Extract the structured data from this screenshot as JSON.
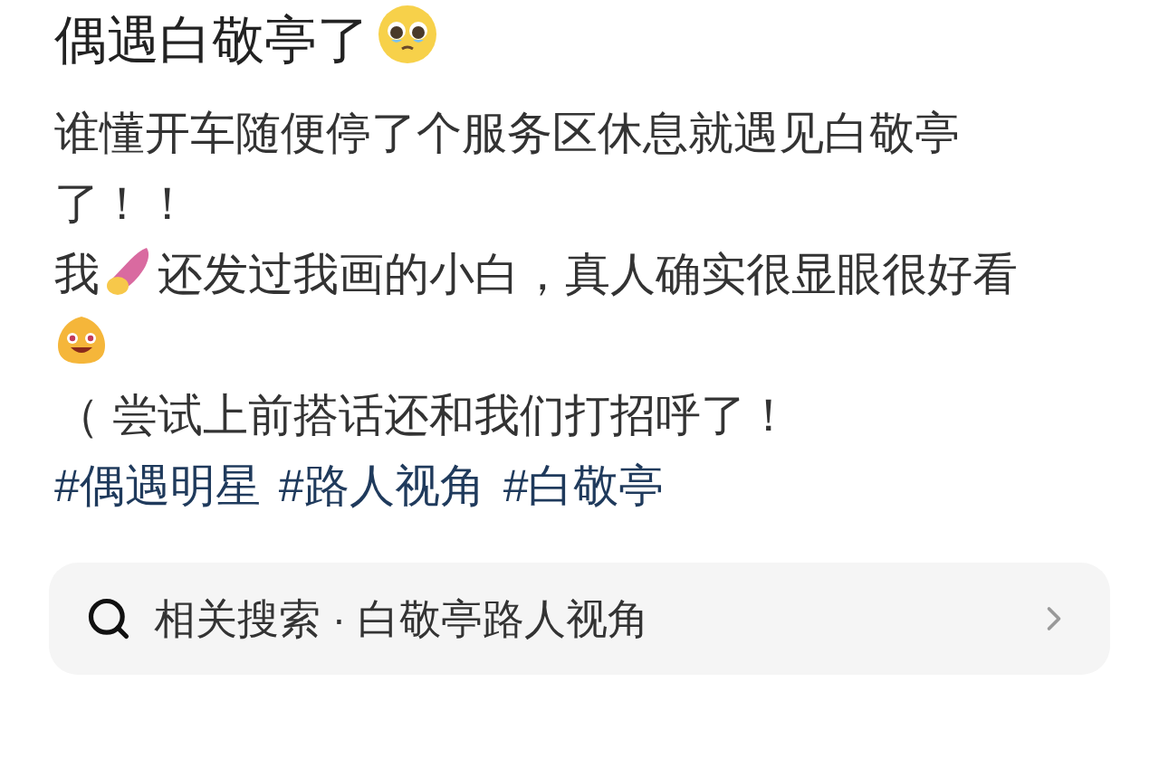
{
  "title": "偶遇白敬亭了",
  "paragraphs": [
    [
      {
        "kind": "text",
        "text": "谁懂开车随便停了个服务区休息就遇见白敬亭了！！"
      }
    ],
    [
      {
        "kind": "text",
        "text": "我"
      },
      {
        "kind": "sweet_potato"
      },
      {
        "kind": "text",
        "text": "还发过我画的小白，真人确实很显眼很好看"
      },
      {
        "kind": "grin"
      }
    ],
    [
      {
        "kind": "text",
        "text": "（ 尝试上前搭话还和我们打招呼了！"
      }
    ]
  ],
  "hashtags": [
    "#偶遇明星",
    "#路人视角",
    "#白敬亭"
  ],
  "related_search": {
    "label": "相关搜索 · 白敬亭路人视角"
  }
}
